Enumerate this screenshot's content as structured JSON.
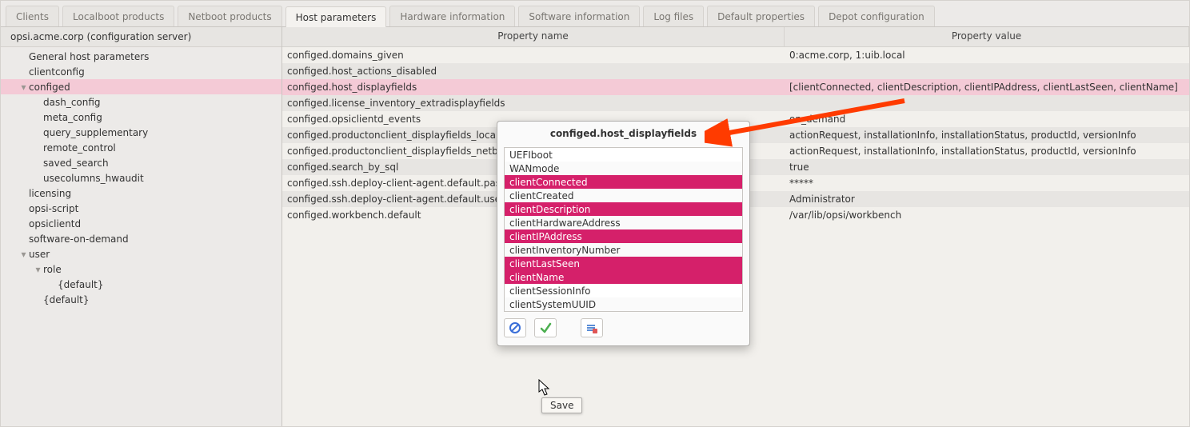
{
  "tabs": [
    {
      "label": "Clients"
    },
    {
      "label": "Localboot products"
    },
    {
      "label": "Netboot products"
    },
    {
      "label": "Host parameters",
      "active": true
    },
    {
      "label": "Hardware information"
    },
    {
      "label": "Software information"
    },
    {
      "label": "Log files"
    },
    {
      "label": "Default properties"
    },
    {
      "label": "Depot configuration"
    }
  ],
  "sidebar": {
    "header": "opsi.acme.corp (configuration server)",
    "items": [
      {
        "label": "General host parameters",
        "indent": 1
      },
      {
        "label": "clientconfig",
        "indent": 1
      },
      {
        "label": "configed",
        "indent": 1,
        "collapsible": true,
        "open": true,
        "selected": true
      },
      {
        "label": "dash_config",
        "indent": 2
      },
      {
        "label": "meta_config",
        "indent": 2
      },
      {
        "label": "query_supplementary",
        "indent": 2
      },
      {
        "label": "remote_control",
        "indent": 2
      },
      {
        "label": "saved_search",
        "indent": 2
      },
      {
        "label": "usecolumns_hwaudit",
        "indent": 2
      },
      {
        "label": "licensing",
        "indent": 1
      },
      {
        "label": "opsi-script",
        "indent": 1
      },
      {
        "label": "opsiclientd",
        "indent": 1
      },
      {
        "label": "software-on-demand",
        "indent": 1
      },
      {
        "label": "user",
        "indent": 1,
        "collapsible": true,
        "open": true
      },
      {
        "label": "role",
        "indent": 2,
        "collapsible": true,
        "open": true
      },
      {
        "label": "{default}",
        "indent": 3
      },
      {
        "label": "{default}",
        "indent": 2
      }
    ]
  },
  "columns": {
    "name": "Property name",
    "value": "Property value"
  },
  "rows": [
    {
      "name": "configed.domains_given",
      "value": "0:acme.corp, 1:uib.local"
    },
    {
      "name": "configed.host_actions_disabled",
      "value": ""
    },
    {
      "name": "configed.host_displayfields",
      "value": "[clientConnected, clientDescription, clientIPAddress, clientLastSeen, clientName]",
      "selected": true
    },
    {
      "name": "configed.license_inventory_extradisplayfields",
      "value": ""
    },
    {
      "name": "configed.opsiclientd_events",
      "value": "on_demand"
    },
    {
      "name": "configed.productonclient_displayfields_localboot",
      "value": "actionRequest, installationInfo, installationStatus, productId, versionInfo"
    },
    {
      "name": "configed.productonclient_displayfields_netboot",
      "value": "actionRequest, installationInfo, installationStatus, productId, versionInfo"
    },
    {
      "name": "configed.search_by_sql",
      "value": "true"
    },
    {
      "name": "configed.ssh.deploy-client-agent.default.password",
      "value": "*****"
    },
    {
      "name": "configed.ssh.deploy-client-agent.default.user",
      "value": "Administrator"
    },
    {
      "name": "configed.workbench.default",
      "value": "/var/lib/opsi/workbench"
    }
  ],
  "popup": {
    "title": "configed.host_displayfields",
    "options": [
      {
        "label": "UEFIboot"
      },
      {
        "label": "WANmode"
      },
      {
        "label": "clientConnected",
        "selected": true
      },
      {
        "label": "clientCreated"
      },
      {
        "label": "clientDescription",
        "selected": true
      },
      {
        "label": "clientHardwareAddress"
      },
      {
        "label": "clientIPAddress",
        "selected": true
      },
      {
        "label": "clientInventoryNumber"
      },
      {
        "label": "clientLastSeen",
        "selected": true
      },
      {
        "label": "clientName",
        "selected": true
      },
      {
        "label": "clientSessionInfo"
      },
      {
        "label": "clientSystemUUID"
      }
    ],
    "tooltip": "Save"
  }
}
